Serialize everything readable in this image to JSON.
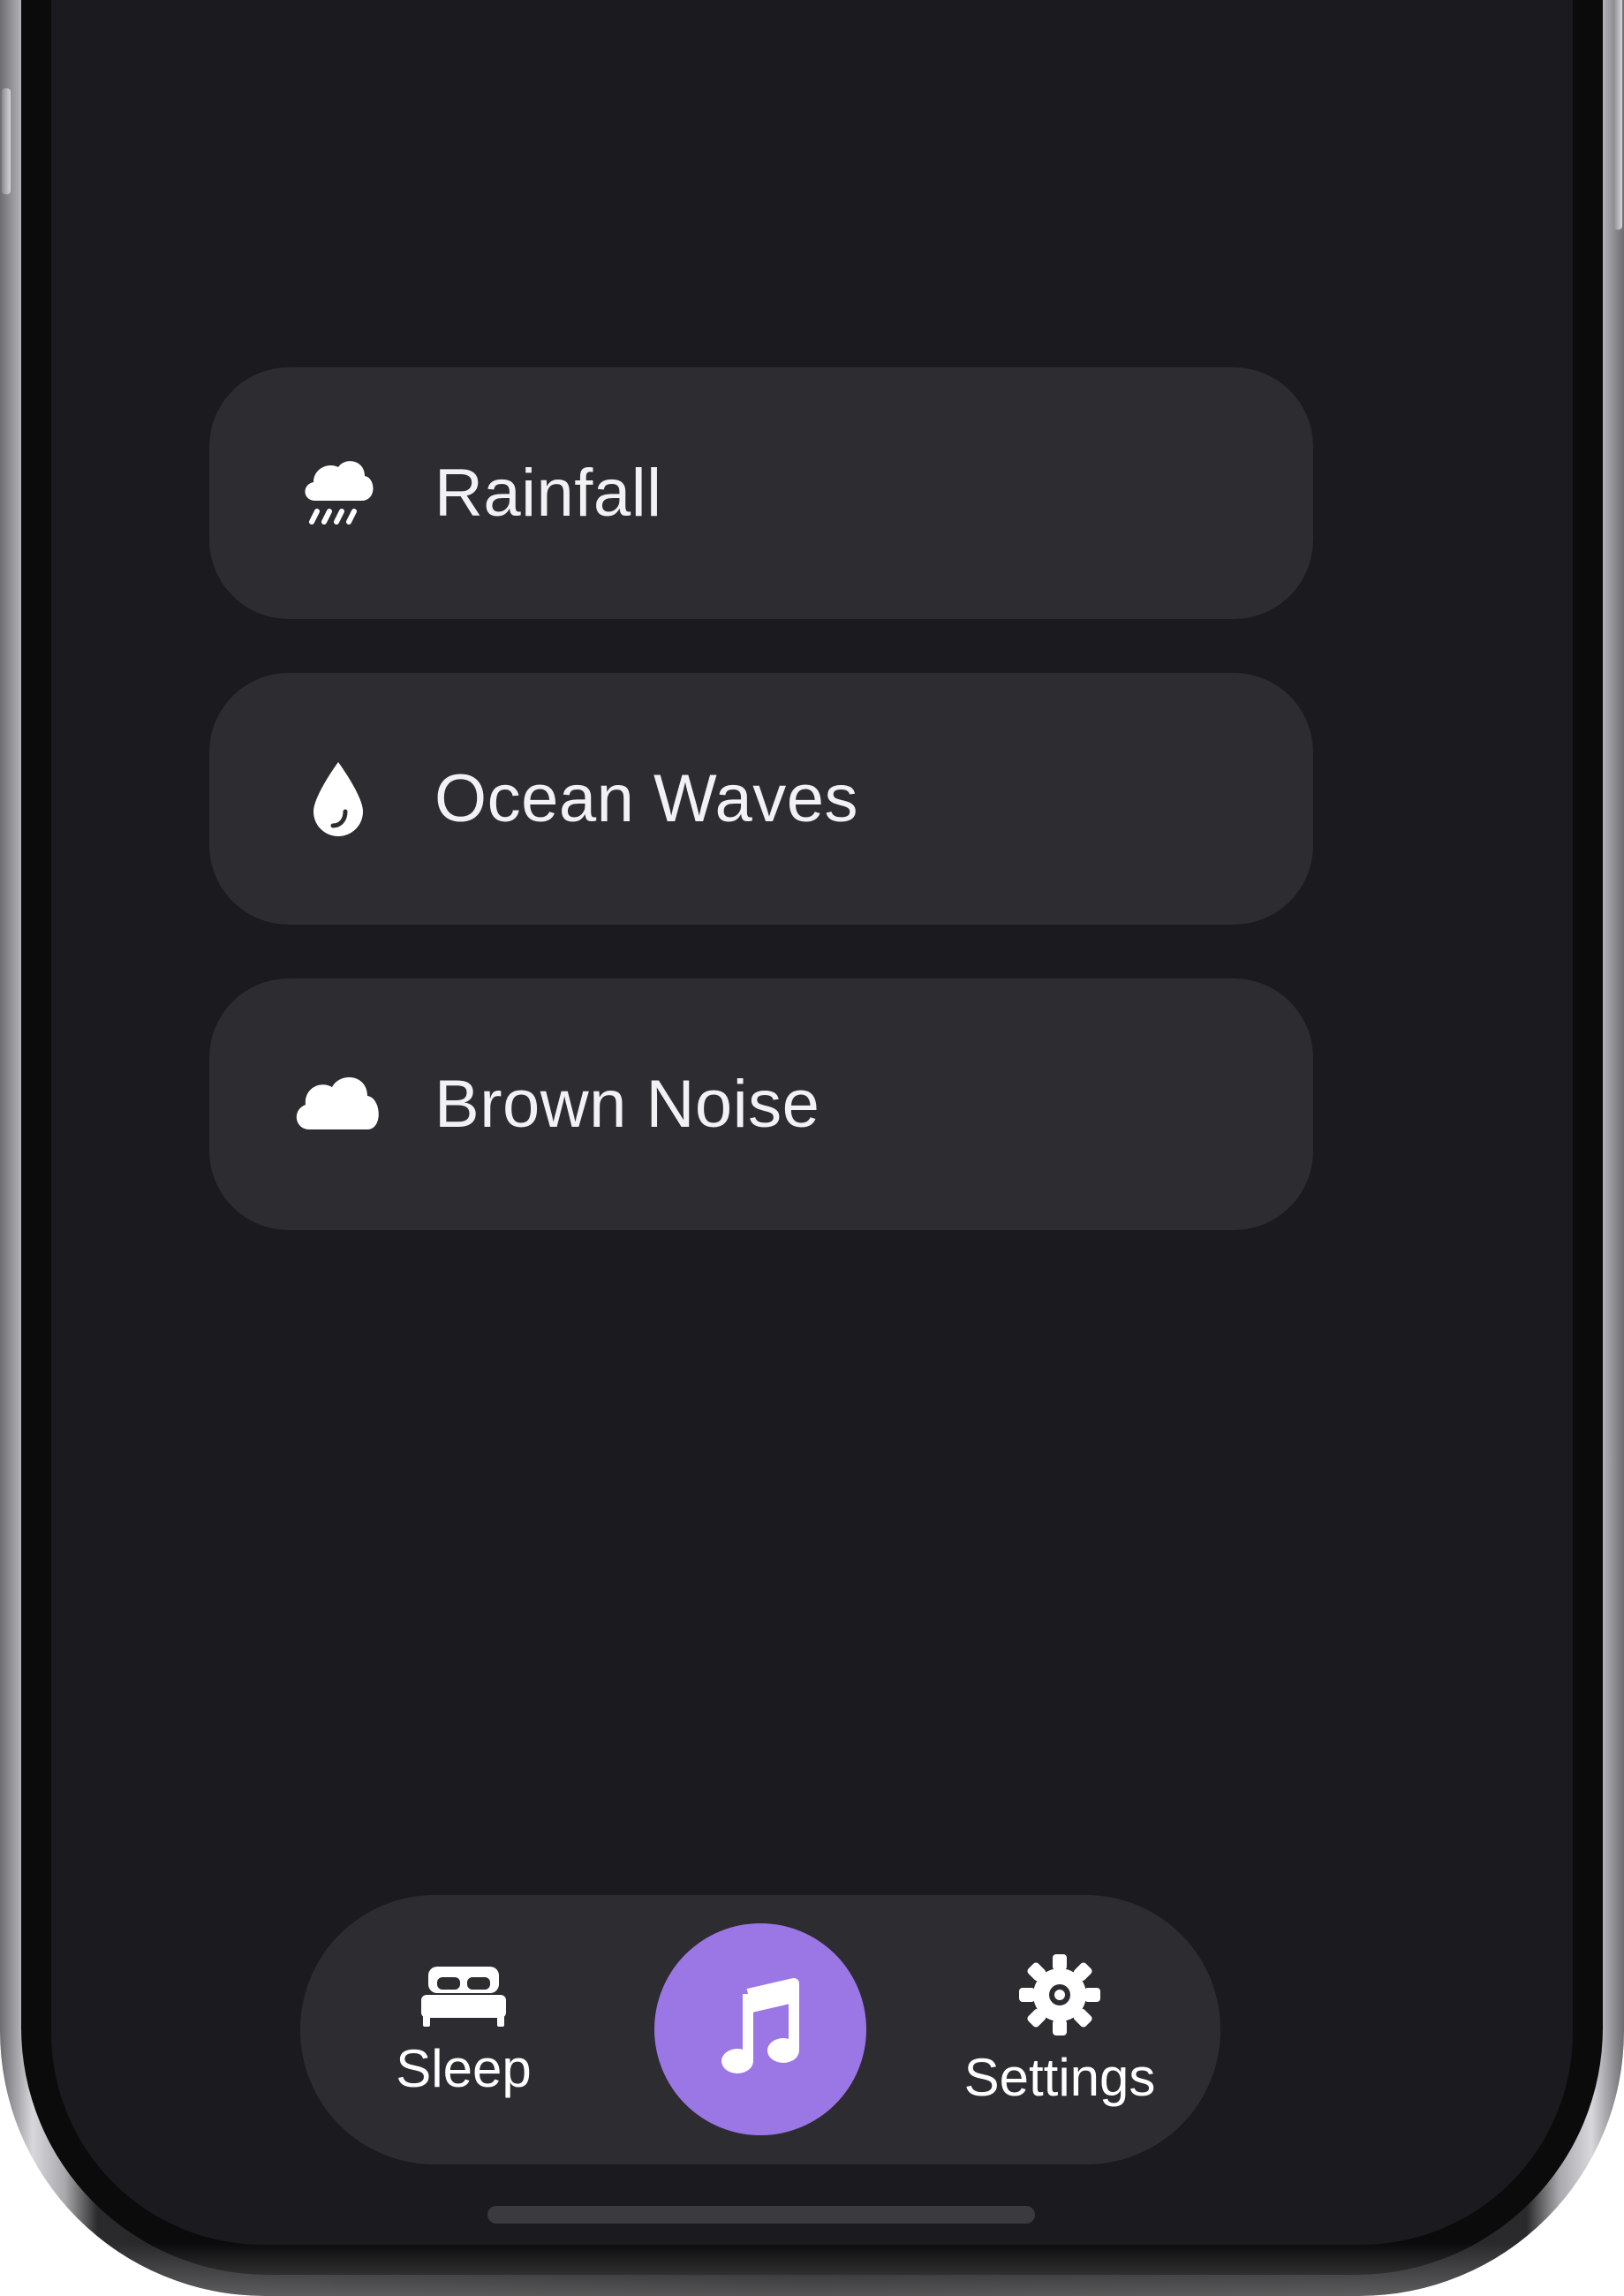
{
  "sounds": {
    "items": [
      {
        "label": "Rainfall",
        "icon": "cloud-rain-icon"
      },
      {
        "label": "Ocean Waves",
        "icon": "water-drop-icon"
      },
      {
        "label": "Brown Noise",
        "icon": "cloud-icon"
      }
    ]
  },
  "tabbar": {
    "sleep_label": "Sleep",
    "settings_label": "Settings",
    "center_icon": "music-note-icon"
  },
  "colors": {
    "accent": "#9b77e6",
    "card": "#2c2c31",
    "background": "#1b1b1f"
  }
}
